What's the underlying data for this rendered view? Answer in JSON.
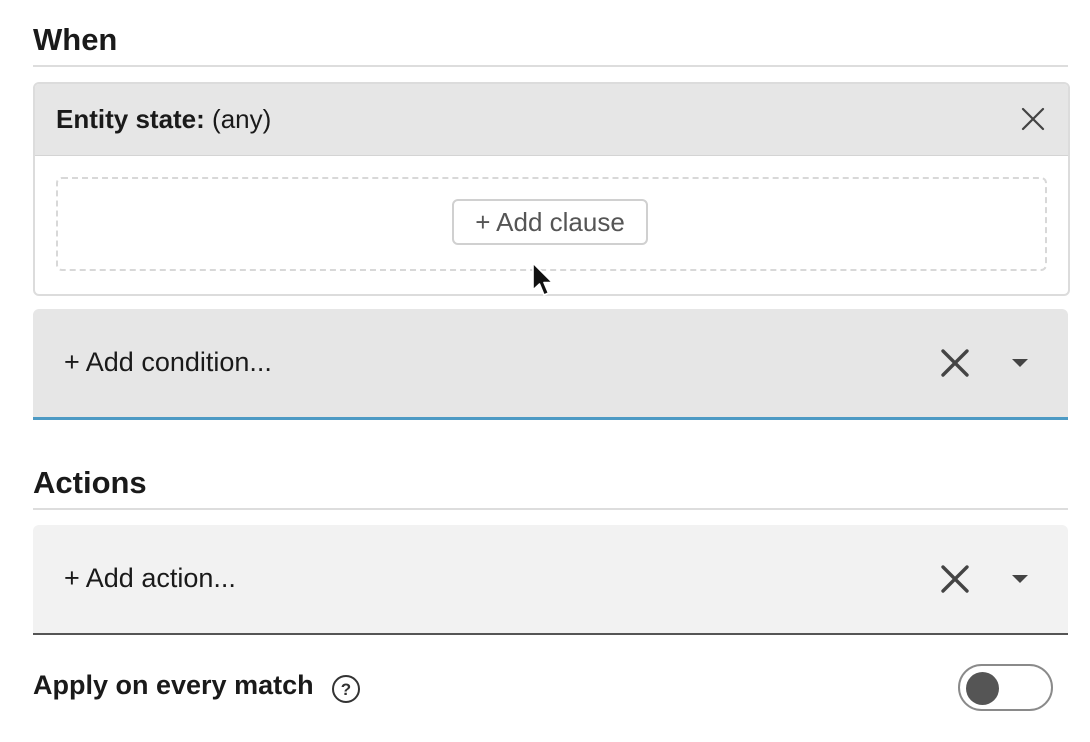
{
  "when_section": {
    "title": "When",
    "condition_card": {
      "label": "Entity state:",
      "value": "(any)",
      "close_icon": "close-icon",
      "add_clause_label": "+ Add clause"
    },
    "add_condition": {
      "placeholder": "+ Add condition...",
      "clear_icon": "clear-icon",
      "dropdown_icon": "caret-down-icon",
      "focus_color": "#4d9ac4"
    }
  },
  "actions_section": {
    "title": "Actions",
    "add_action": {
      "placeholder": "+ Add action...",
      "clear_icon": "clear-icon",
      "dropdown_icon": "caret-down-icon"
    }
  },
  "options": {
    "apply_every_match": {
      "label": "Apply on every match",
      "help_icon": "help-circle-icon",
      "enabled": false
    }
  },
  "colors": {
    "accent": "#4d9ac4",
    "header_bg": "#e6e6e6",
    "action_bg": "#f2f2f2",
    "text": "#1a1a1a"
  }
}
